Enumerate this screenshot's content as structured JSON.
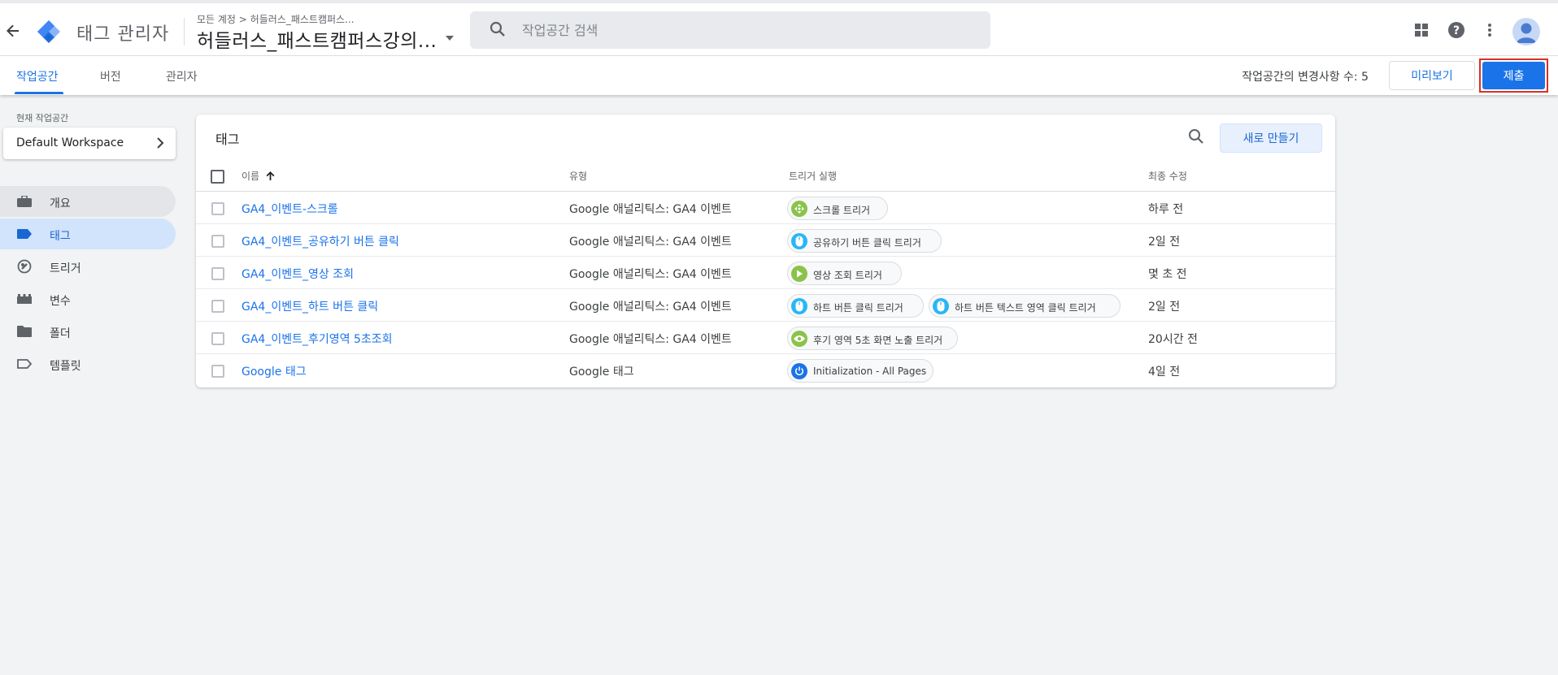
{
  "header": {
    "app_title": "태그 관리자",
    "breadcrumb": "모든 계정 > 허들러스_패스트캠퍼스...",
    "container_name": "허들러스_패스트캠퍼스강의...",
    "search_placeholder": "작업공간 검색"
  },
  "subnav": {
    "tabs": [
      {
        "label": "작업공간"
      },
      {
        "label": "버전"
      },
      {
        "label": "관리자"
      }
    ],
    "changes_text": "작업공간의 변경사항 수: 5",
    "preview_label": "미리보기",
    "submit_label": "제출"
  },
  "sidebar": {
    "workspace_label": "현재 작업공간",
    "workspace_name": "Default Workspace",
    "items": [
      {
        "label": "개요",
        "icon": "briefcase-icon"
      },
      {
        "label": "태그",
        "icon": "tag-icon"
      },
      {
        "label": "트리거",
        "icon": "trigger-icon"
      },
      {
        "label": "변수",
        "icon": "variable-icon"
      },
      {
        "label": "폴더",
        "icon": "folder-icon"
      },
      {
        "label": "템플릿",
        "icon": "template-icon"
      }
    ]
  },
  "tags_card": {
    "title": "태그",
    "new_button": "새로 만들기",
    "columns": {
      "name": "이름",
      "type": "유형",
      "trigger": "트리거 실행",
      "modified": "최종 수정"
    },
    "rows": [
      {
        "name": "GA4_이벤트-스크롤",
        "type": "Google 애널리틱스: GA4 이벤트",
        "triggers": [
          {
            "label": "스크롤 트리거",
            "icon": "scroll-icon",
            "color": "#8bc34a"
          }
        ],
        "modified": "하루 전"
      },
      {
        "name": "GA4_이벤트_공유하기 버튼 클릭",
        "type": "Google 애널리틱스: GA4 이벤트",
        "triggers": [
          {
            "label": "공유하기 버튼 클릭 트리거",
            "icon": "mouse-icon",
            "color": "#29b6f6"
          }
        ],
        "modified": "2일 전"
      },
      {
        "name": "GA4_이벤트_영상 조회",
        "type": "Google 애널리틱스: GA4 이벤트",
        "triggers": [
          {
            "label": "영상 조회 트리거",
            "icon": "play-icon",
            "color": "#8bc34a"
          }
        ],
        "modified": "몇 초 전"
      },
      {
        "name": "GA4_이벤트_하트 버튼 클릭",
        "type": "Google 애널리틱스: GA4 이벤트",
        "triggers": [
          {
            "label": "하트 버튼 클릭 트리거",
            "icon": "mouse-icon",
            "color": "#29b6f6"
          },
          {
            "label": "하트 버튼 텍스트 영역 클릭 트리거",
            "icon": "mouse-icon",
            "color": "#29b6f6"
          }
        ],
        "modified": "2일 전"
      },
      {
        "name": "GA4_이벤트_후기영역 5초조회",
        "type": "Google 애널리틱스: GA4 이벤트",
        "triggers": [
          {
            "label": "후기 영역 5초 화면 노출 트리거",
            "icon": "eye-icon",
            "color": "#8bc34a"
          }
        ],
        "modified": "20시간 전"
      },
      {
        "name": "Google 태그",
        "type": "Google 태그",
        "triggers": [
          {
            "label": "Initialization - All Pages",
            "icon": "power-icon",
            "color": "#1a73e8"
          }
        ],
        "modified": "4일 전"
      }
    ]
  },
  "colors": {
    "accent": "#1a73e8",
    "highlight_border": "#d93025"
  }
}
